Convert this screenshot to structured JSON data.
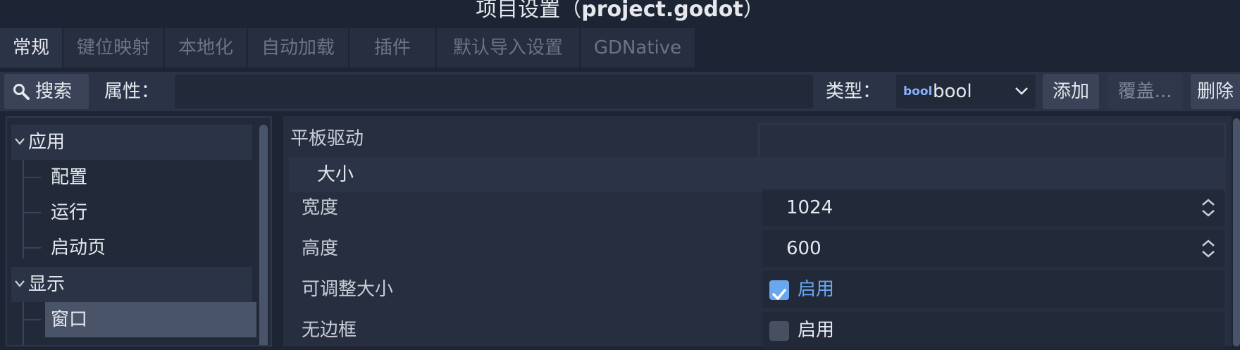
{
  "window": {
    "title_prefix": "项目设置（",
    "project_name": "project.godot",
    "title_suffix": "）"
  },
  "tabs": [
    {
      "label": "常规",
      "active": true
    },
    {
      "label": "键位映射"
    },
    {
      "label": "本地化"
    },
    {
      "label": "自动加载"
    },
    {
      "label": "插件"
    },
    {
      "label": "默认导入设置"
    },
    {
      "label": "GDNative"
    }
  ],
  "toolbar": {
    "search_label": "搜索",
    "property_label": "属性：",
    "property_value": "",
    "type_label": "类型：",
    "type_icon_text": "bool",
    "type_value": "bool",
    "add_label": "添加",
    "override_label": "覆盖...",
    "delete_label": "删除"
  },
  "sidebar": {
    "categories": [
      {
        "label": "应用",
        "expanded": true,
        "items": [
          "配置",
          "运行",
          "启动页"
        ]
      },
      {
        "label": "显示",
        "expanded": true,
        "items": [
          "窗口"
        ],
        "selected": "窗口"
      }
    ]
  },
  "inspector": {
    "tablet_driver_label": "平板驱动",
    "tablet_driver_value": "",
    "section_size": "大小",
    "width_label": "宽度",
    "width_value": "1024",
    "height_label": "高度",
    "height_value": "600",
    "resizable_label": "可调整大小",
    "resizable_checked": true,
    "resizable_text": "启用",
    "borderless_label": "无边框",
    "borderless_checked": false,
    "borderless_text": "启用"
  },
  "colors": {
    "background": "#1d2433",
    "panel": "#262e3f",
    "accent": "#6aa7ee",
    "text": "#e6e8ee",
    "dim_text": "#6b7384"
  }
}
